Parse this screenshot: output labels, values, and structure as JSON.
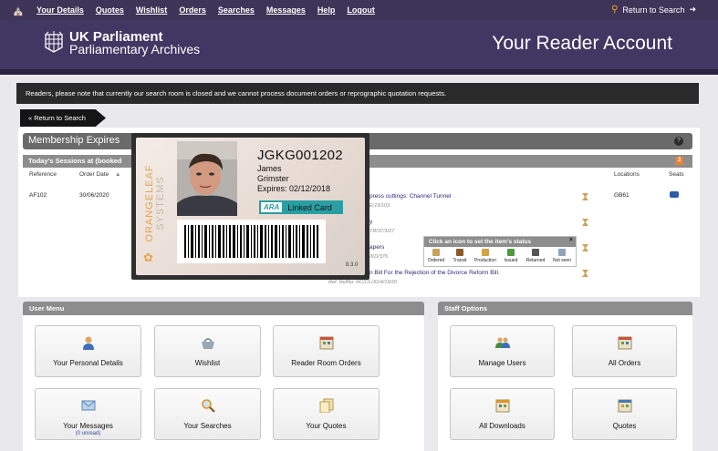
{
  "nav": {
    "items": [
      "Your Details",
      "Quotes",
      "Wishlist",
      "Orders",
      "Searches",
      "Messages",
      "Help",
      "Logout"
    ],
    "return_label": "Return to Search"
  },
  "banner": {
    "org_line1": "UK Parliament",
    "org_line2": "Parliamentary Archives",
    "title": "Your Reader Account"
  },
  "notice": "Readers, please note that currently our search room is closed and we cannot process document orders or reprographic quotation requests.",
  "return_tab": "« Return to Search",
  "membership": {
    "title": "Membership Expires",
    "info_icon": "?"
  },
  "sessions": {
    "title": "Today's Sessions at (booked",
    "badge": "3",
    "columns": [
      "Reference",
      "Order Date",
      "Locations",
      "Seats"
    ],
    "row": {
      "reference": "AF102",
      "order_date": "30/06/2020",
      "location": "GB61"
    },
    "docs": [
      {
        "title": "press cuttings: Channel Tunnel",
        "ref": "E/19/103"
      },
      {
        "title": "y",
        "ref": "TR/37/3/27"
      },
      {
        "title": "apers",
        "ref": "/KD/375"
      },
      {
        "title": "n Bill For the Rejection of the Divorce Reform Bill.",
        "ref": "Ref: RefNo: HC/CL/JO/4/19/20"
      }
    ]
  },
  "status_popup": {
    "title": "Click an icon to set the item's status",
    "close": "×",
    "statuses": [
      "Ordered",
      "Transit",
      "Production",
      "Issued",
      "Returned",
      "Not seen"
    ]
  },
  "card": {
    "brand_a": "ORANGELEAF",
    "brand_b": "SYSTEMS",
    "number": "JGKG001202",
    "first_name": "James",
    "last_name": "Grimster",
    "expires": "Expires: 02/12/2018",
    "ara_logo": "ARA",
    "linked": "Linked Card",
    "version": "8.3.0"
  },
  "user_menu": {
    "title": "User Menu",
    "tiles": [
      {
        "label": "Your Personal Details"
      },
      {
        "label": "Wishlist"
      },
      {
        "label": "Reader Room Orders"
      },
      {
        "label": "Your Messages",
        "sub": "(0 unread)"
      },
      {
        "label": "Your Searches"
      },
      {
        "label": "Your Quotes"
      }
    ]
  },
  "staff": {
    "title": "Staff Options",
    "tiles": [
      {
        "label": "Manage Users"
      },
      {
        "label": "All Orders"
      },
      {
        "label": "All Downloads"
      },
      {
        "label": "Quotes"
      }
    ]
  },
  "colors": {
    "nav_bg": "#3e3458",
    "banner_bg": "#413763",
    "accent": "#e7a24c",
    "ara_teal": "#2a9fa3"
  }
}
